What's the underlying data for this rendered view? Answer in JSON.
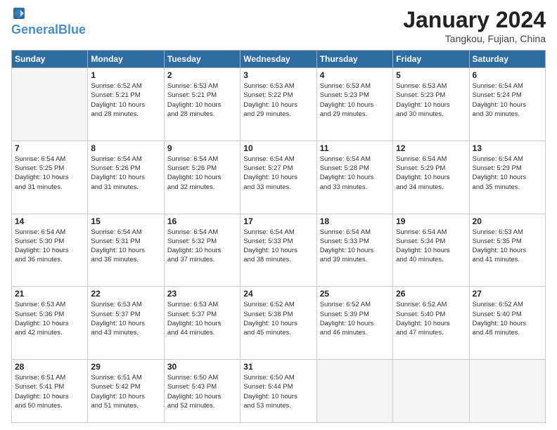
{
  "header": {
    "logo_line1": "General",
    "logo_line2": "Blue",
    "month": "January 2024",
    "location": "Tangkou, Fujian, China"
  },
  "days_of_week": [
    "Sunday",
    "Monday",
    "Tuesday",
    "Wednesday",
    "Thursday",
    "Friday",
    "Saturday"
  ],
  "weeks": [
    [
      {
        "day": "",
        "info": ""
      },
      {
        "day": "1",
        "info": "Sunrise: 6:52 AM\nSunset: 5:21 PM\nDaylight: 10 hours\nand 28 minutes."
      },
      {
        "day": "2",
        "info": "Sunrise: 6:53 AM\nSunset: 5:21 PM\nDaylight: 10 hours\nand 28 minutes."
      },
      {
        "day": "3",
        "info": "Sunrise: 6:53 AM\nSunset: 5:22 PM\nDaylight: 10 hours\nand 29 minutes."
      },
      {
        "day": "4",
        "info": "Sunrise: 6:53 AM\nSunset: 5:23 PM\nDaylight: 10 hours\nand 29 minutes."
      },
      {
        "day": "5",
        "info": "Sunrise: 6:53 AM\nSunset: 5:23 PM\nDaylight: 10 hours\nand 30 minutes."
      },
      {
        "day": "6",
        "info": "Sunrise: 6:54 AM\nSunset: 5:24 PM\nDaylight: 10 hours\nand 30 minutes."
      }
    ],
    [
      {
        "day": "7",
        "info": "Sunrise: 6:54 AM\nSunset: 5:25 PM\nDaylight: 10 hours\nand 31 minutes."
      },
      {
        "day": "8",
        "info": "Sunrise: 6:54 AM\nSunset: 5:26 PM\nDaylight: 10 hours\nand 31 minutes."
      },
      {
        "day": "9",
        "info": "Sunrise: 6:54 AM\nSunset: 5:26 PM\nDaylight: 10 hours\nand 32 minutes."
      },
      {
        "day": "10",
        "info": "Sunrise: 6:54 AM\nSunset: 5:27 PM\nDaylight: 10 hours\nand 33 minutes."
      },
      {
        "day": "11",
        "info": "Sunrise: 6:54 AM\nSunset: 5:28 PM\nDaylight: 10 hours\nand 33 minutes."
      },
      {
        "day": "12",
        "info": "Sunrise: 6:54 AM\nSunset: 5:29 PM\nDaylight: 10 hours\nand 34 minutes."
      },
      {
        "day": "13",
        "info": "Sunrise: 6:54 AM\nSunset: 5:29 PM\nDaylight: 10 hours\nand 35 minutes."
      }
    ],
    [
      {
        "day": "14",
        "info": "Sunrise: 6:54 AM\nSunset: 5:30 PM\nDaylight: 10 hours\nand 36 minutes."
      },
      {
        "day": "15",
        "info": "Sunrise: 6:54 AM\nSunset: 5:31 PM\nDaylight: 10 hours\nand 36 minutes."
      },
      {
        "day": "16",
        "info": "Sunrise: 6:54 AM\nSunset: 5:32 PM\nDaylight: 10 hours\nand 37 minutes."
      },
      {
        "day": "17",
        "info": "Sunrise: 6:54 AM\nSunset: 5:33 PM\nDaylight: 10 hours\nand 38 minutes."
      },
      {
        "day": "18",
        "info": "Sunrise: 6:54 AM\nSunset: 5:33 PM\nDaylight: 10 hours\nand 39 minutes."
      },
      {
        "day": "19",
        "info": "Sunrise: 6:54 AM\nSunset: 5:34 PM\nDaylight: 10 hours\nand 40 minutes."
      },
      {
        "day": "20",
        "info": "Sunrise: 6:53 AM\nSunset: 5:35 PM\nDaylight: 10 hours\nand 41 minutes."
      }
    ],
    [
      {
        "day": "21",
        "info": "Sunrise: 6:53 AM\nSunset: 5:36 PM\nDaylight: 10 hours\nand 42 minutes."
      },
      {
        "day": "22",
        "info": "Sunrise: 6:53 AM\nSunset: 5:37 PM\nDaylight: 10 hours\nand 43 minutes."
      },
      {
        "day": "23",
        "info": "Sunrise: 6:53 AM\nSunset: 5:37 PM\nDaylight: 10 hours\nand 44 minutes."
      },
      {
        "day": "24",
        "info": "Sunrise: 6:52 AM\nSunset: 5:38 PM\nDaylight: 10 hours\nand 45 minutes."
      },
      {
        "day": "25",
        "info": "Sunrise: 6:52 AM\nSunset: 5:39 PM\nDaylight: 10 hours\nand 46 minutes."
      },
      {
        "day": "26",
        "info": "Sunrise: 6:52 AM\nSunset: 5:40 PM\nDaylight: 10 hours\nand 47 minutes."
      },
      {
        "day": "27",
        "info": "Sunrise: 6:52 AM\nSunset: 5:40 PM\nDaylight: 10 hours\nand 48 minutes."
      }
    ],
    [
      {
        "day": "28",
        "info": "Sunrise: 6:51 AM\nSunset: 5:41 PM\nDaylight: 10 hours\nand 50 minutes."
      },
      {
        "day": "29",
        "info": "Sunrise: 6:51 AM\nSunset: 5:42 PM\nDaylight: 10 hours\nand 51 minutes."
      },
      {
        "day": "30",
        "info": "Sunrise: 6:50 AM\nSunset: 5:43 PM\nDaylight: 10 hours\nand 52 minutes."
      },
      {
        "day": "31",
        "info": "Sunrise: 6:50 AM\nSunset: 5:44 PM\nDaylight: 10 hours\nand 53 minutes."
      },
      {
        "day": "",
        "info": ""
      },
      {
        "day": "",
        "info": ""
      },
      {
        "day": "",
        "info": ""
      }
    ]
  ]
}
